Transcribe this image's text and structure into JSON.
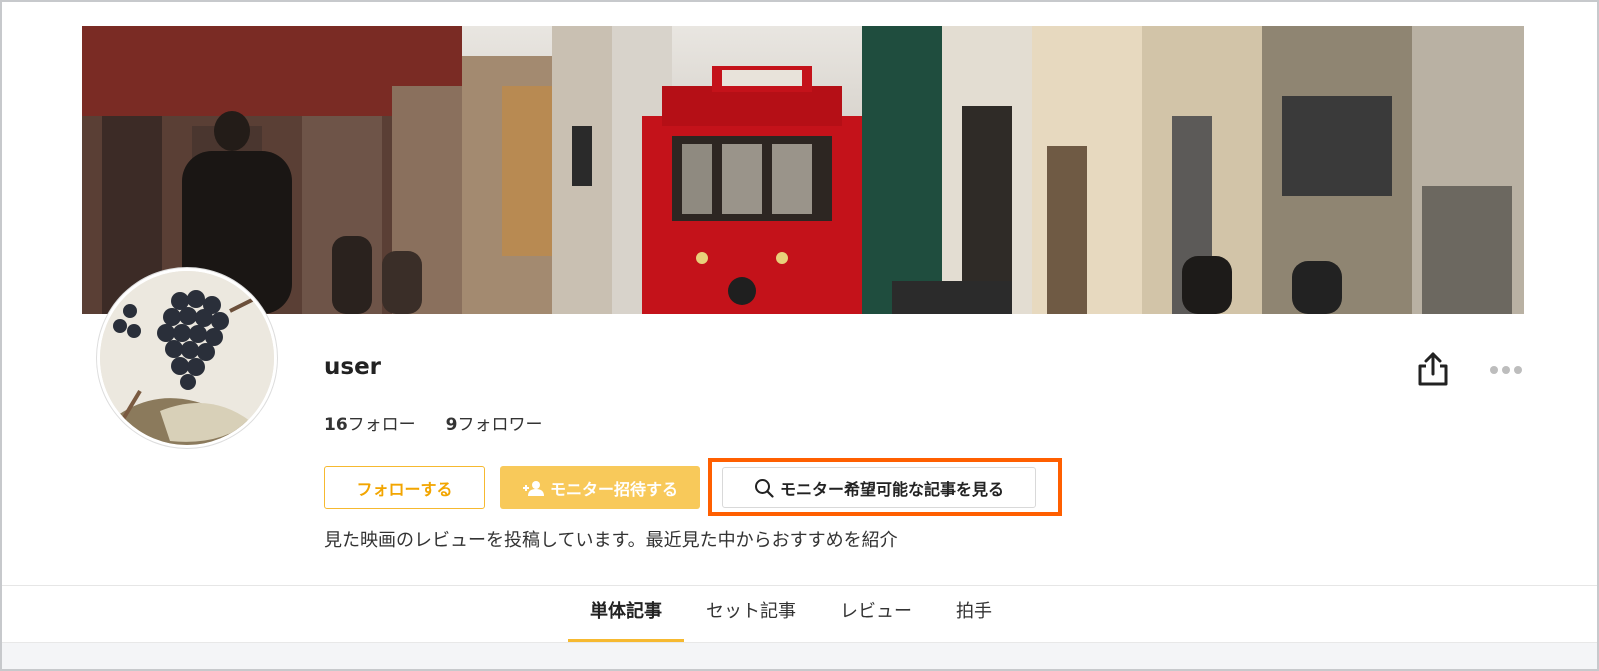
{
  "profile": {
    "username": "user",
    "following_count": "16",
    "following_label": "フォロー",
    "followers_count": "9",
    "followers_label": "フォロワー",
    "bio": "見た映画のレビューを投稿しています。最近見た中からおすすめを紹介"
  },
  "actions": {
    "follow_label": "フォローする",
    "invite_label": "モニター招待する",
    "search_label": "モニター希望可能な記事を見る"
  },
  "tabs": [
    {
      "label": "単体記事",
      "active": true
    },
    {
      "label": "セット記事",
      "active": false
    },
    {
      "label": "レビュー",
      "active": false
    },
    {
      "label": "拍手",
      "active": false
    }
  ],
  "colors": {
    "accent": "#f6b930",
    "invite_bg": "#f8c95a",
    "highlight": "#ff5f00"
  },
  "icons": {
    "share": "share-icon",
    "more": "more-horizontal-icon",
    "invite": "add-user-icon",
    "search": "search-icon"
  }
}
